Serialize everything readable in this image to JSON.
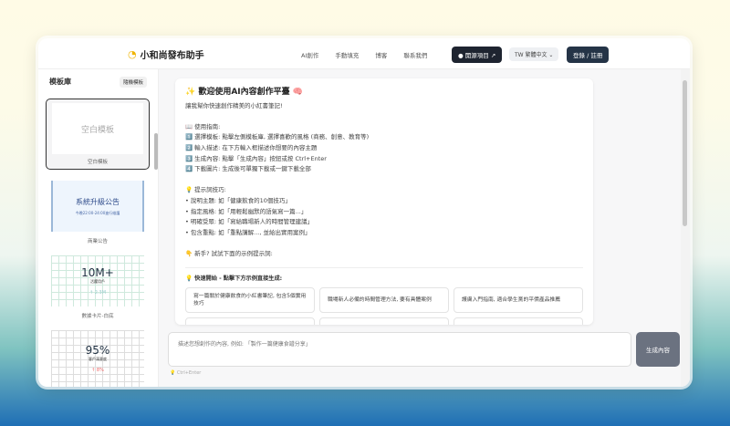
{
  "header": {
    "logo": "小和尚發布助手",
    "nav": [
      "AI創作",
      "手動填充",
      "博客",
      "聯系我們"
    ],
    "github": "開源項目 ↗",
    "lang": "TW 繁體中文 ⌄",
    "login": "登錄 / 註冊"
  },
  "sidebar": {
    "title": "模板庫",
    "random": "隨機模板",
    "templates": [
      {
        "name": "空白模板",
        "preview": "空白模板"
      },
      {
        "name": "商業公告",
        "title": "系統升級公告",
        "sub": "今晚22:00-24:00進行維護"
      },
      {
        "name": "數據卡片-白底",
        "big": "10M+",
        "label": "活躍用戶",
        "delta": "↑ 2.3M"
      },
      {
        "name": "",
        "big": "95%",
        "label": "客戶滿意度",
        "delta": "↑ 8%"
      }
    ]
  },
  "welcome": {
    "title": "✨ 歡迎使用AI內容創作平臺 🧠",
    "sub": "讓我幫你快速創作精美的小紅書筆記!",
    "guide_title": "📖 使用指南:",
    "guide": [
      "1️⃣ 選擇模板: 點擊左側模板庫, 選擇喜歡的風格 (商務、創意、教育等)",
      "2️⃣ 輸入描述: 在下方輸入框描述你想要的內容主題",
      "3️⃣ 生成內容: 點擊「生成內容」按鈕或按 Ctrl+Enter",
      "4️⃣ 下載圖片: 生成後可單獨下載或一鍵下載全部"
    ],
    "tips_title": "💡 提示詞技巧:",
    "tips": [
      "• 說明主題: 如「健康飲食的10個技巧」",
      "• 指定風格: 如「用輕鬆幽默的語氣寫一篇...」",
      "• 明確受眾: 如「寫給職場新人的時間管理建議」",
      "• 包含重點: 如「重點講解..., 並給出實用案例」"
    ],
    "newbie": "👇 新手? 試試下面的示例提示詞:",
    "quick_title": "快速開始 - 點擊下方示例直接生成:",
    "examples": [
      "寫一篇關於健康飲食的小紅書筆記, 包含5個實用技巧",
      "職場新人必備的時間管理方法, 要有具體案例",
      "護膚入門指南, 適合學生黨的平價產品推薦"
    ]
  },
  "input": {
    "placeholder": "描述您想創作的內容, 例如: 「製作一篇健康食譜分享」",
    "generate": "生成內容",
    "hint": "Ctrl+Enter"
  }
}
